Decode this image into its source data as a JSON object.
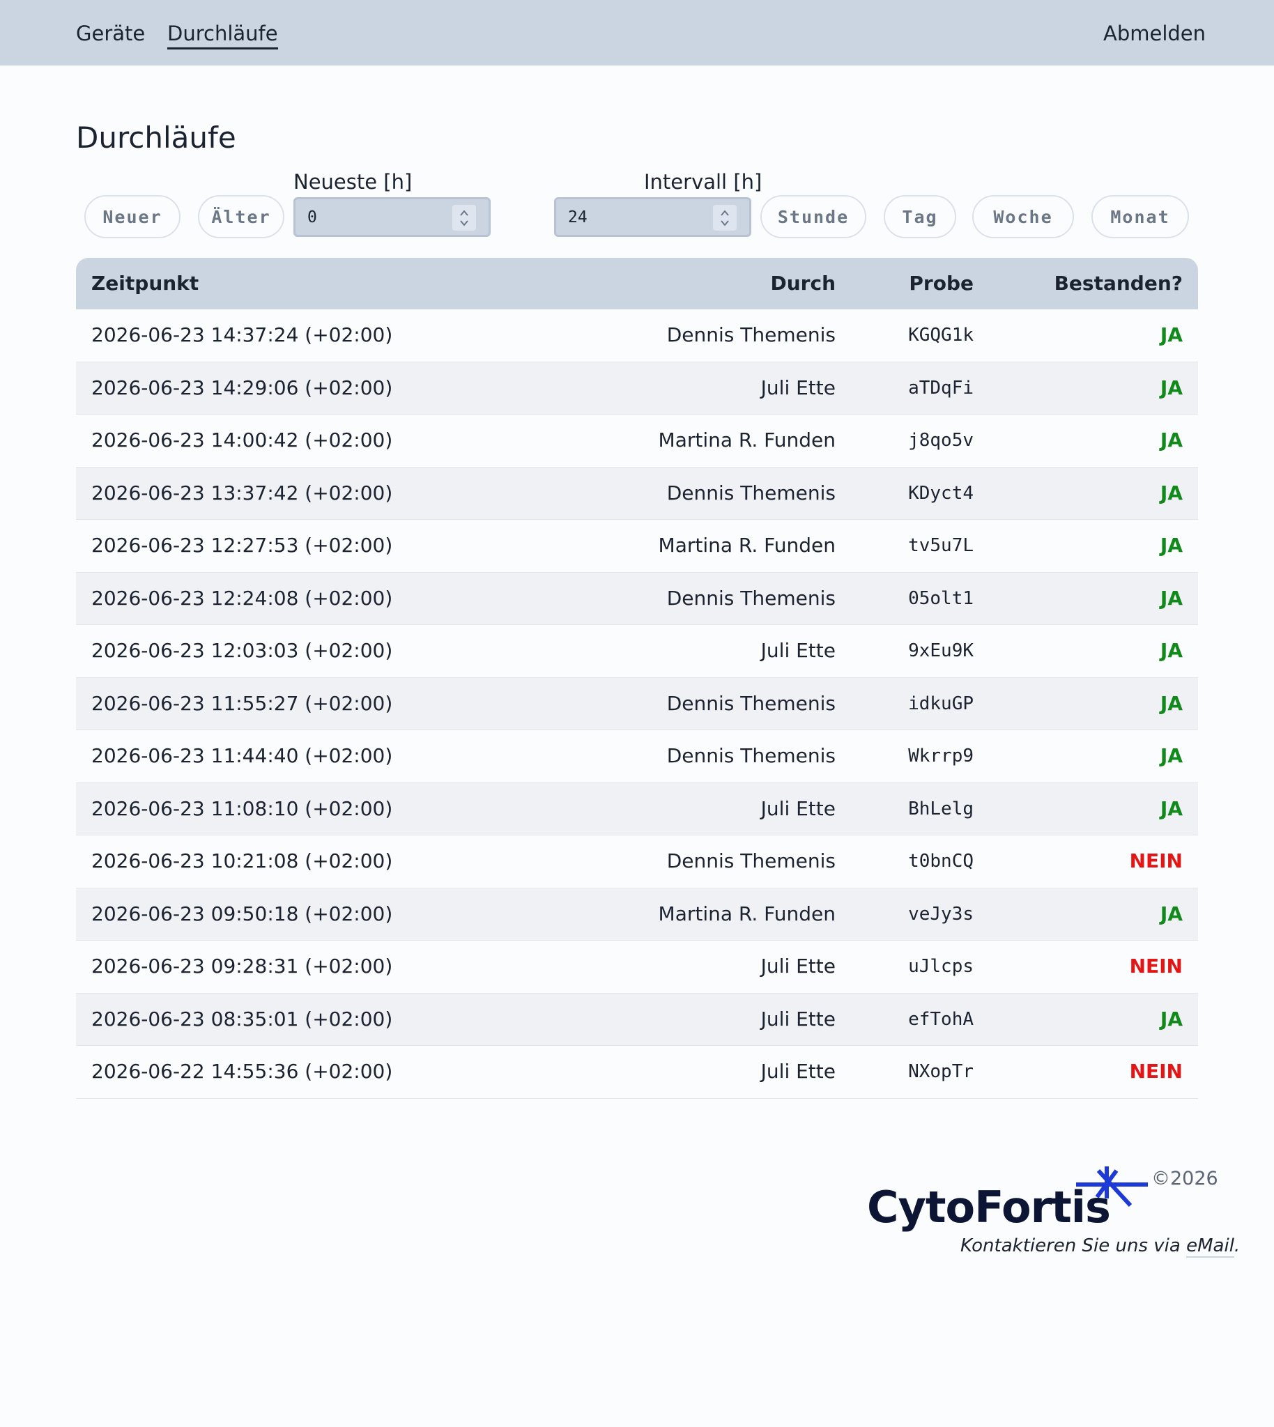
{
  "nav": {
    "items": [
      {
        "label": "Geräte"
      },
      {
        "label": "Durchläufe"
      }
    ],
    "logout_label": "Abmelden"
  },
  "page": {
    "title": "Durchläufe"
  },
  "filters": {
    "newer_label": "Neuer",
    "older_label": "Älter",
    "newest_label": "Neueste [h]",
    "newest_value": "0",
    "interval_label": "Intervall [h]",
    "interval_value": "24",
    "presets": [
      "Stunde",
      "Tag",
      "Woche",
      "Monat"
    ]
  },
  "table": {
    "headers": [
      "Zeitpunkt",
      "Durch",
      "Probe",
      "Bestanden?"
    ],
    "rows": [
      {
        "time": "2026-06-23 14:37:24 (+02:00)",
        "by": "Dennis Themenis",
        "sample": "KGQG1k",
        "passed": "JA"
      },
      {
        "time": "2026-06-23 14:29:06 (+02:00)",
        "by": "Juli Ette",
        "sample": "aTDqFi",
        "passed": "JA"
      },
      {
        "time": "2026-06-23 14:00:42 (+02:00)",
        "by": "Martina R. Funden",
        "sample": "j8qo5v",
        "passed": "JA"
      },
      {
        "time": "2026-06-23 13:37:42 (+02:00)",
        "by": "Dennis Themenis",
        "sample": "KDyct4",
        "passed": "JA"
      },
      {
        "time": "2026-06-23 12:27:53 (+02:00)",
        "by": "Martina R. Funden",
        "sample": "tv5u7L",
        "passed": "JA"
      },
      {
        "time": "2026-06-23 12:24:08 (+02:00)",
        "by": "Dennis Themenis",
        "sample": "05olt1",
        "passed": "JA"
      },
      {
        "time": "2026-06-23 12:03:03 (+02:00)",
        "by": "Juli Ette",
        "sample": "9xEu9K",
        "passed": "JA"
      },
      {
        "time": "2026-06-23 11:55:27 (+02:00)",
        "by": "Dennis Themenis",
        "sample": "idkuGP",
        "passed": "JA"
      },
      {
        "time": "2026-06-23 11:44:40 (+02:00)",
        "by": "Dennis Themenis",
        "sample": "Wkrrp9",
        "passed": "JA"
      },
      {
        "time": "2026-06-23 11:08:10 (+02:00)",
        "by": "Juli Ette",
        "sample": "BhLelg",
        "passed": "JA"
      },
      {
        "time": "2026-06-23 10:21:08 (+02:00)",
        "by": "Dennis Themenis",
        "sample": "t0bnCQ",
        "passed": "NEIN"
      },
      {
        "time": "2026-06-23 09:50:18 (+02:00)",
        "by": "Martina R. Funden",
        "sample": "veJy3s",
        "passed": "JA"
      },
      {
        "time": "2026-06-23 09:28:31 (+02:00)",
        "by": "Juli Ette",
        "sample": "uJlcps",
        "passed": "NEIN"
      },
      {
        "time": "2026-06-23 08:35:01 (+02:00)",
        "by": "Juli Ette",
        "sample": "efTohA",
        "passed": "JA"
      },
      {
        "time": "2026-06-22 14:55:36 (+02:00)",
        "by": "Juli Ette",
        "sample": "NXopTr",
        "passed": "NEIN"
      }
    ]
  },
  "footer": {
    "logo_text": "CytoFortis",
    "logo_icon": "asterisk-star-icon",
    "copyright": "©2026",
    "contact_prefix": "Kontaktieren Sie uns via ",
    "contact_link": "eMail",
    "contact_suffix": "."
  },
  "colors": {
    "topbar": "#cbd5e1",
    "pass": "#12891b",
    "fail": "#e31515",
    "logo_accent": "#1e3ad6",
    "logo_text": "#0c1533"
  }
}
